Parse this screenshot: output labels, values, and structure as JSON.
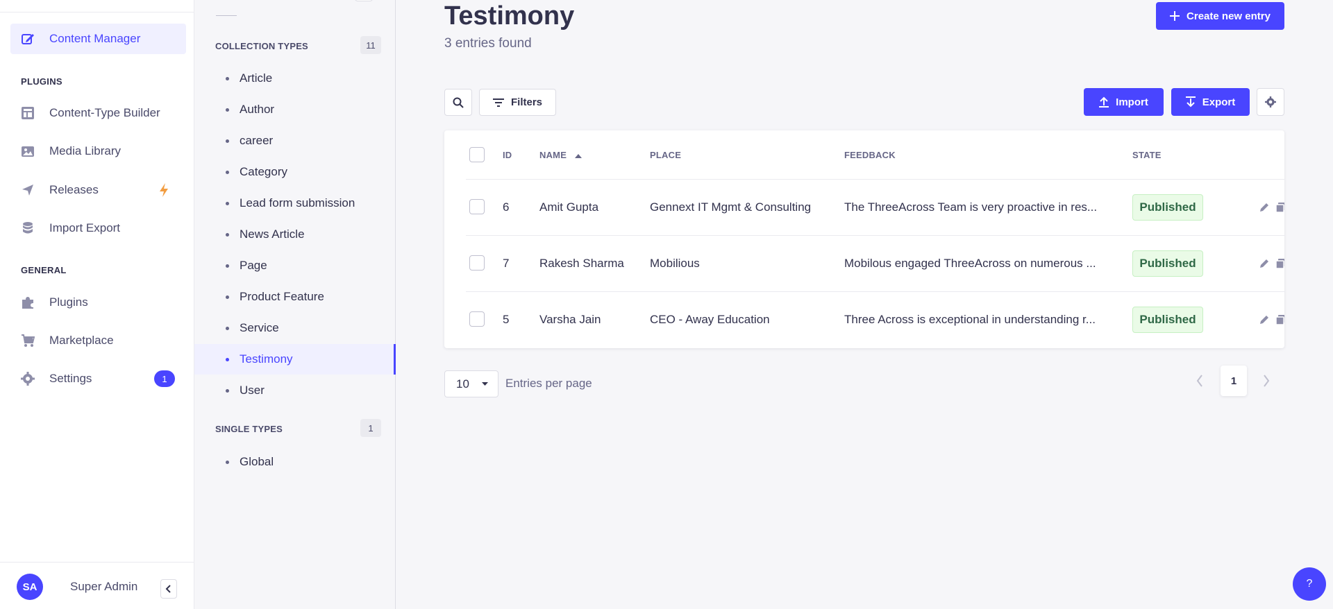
{
  "mainnav": {
    "content_manager": "Content Manager",
    "plugins_section": "PLUGINS",
    "content_type_builder": "Content-Type Builder",
    "media_library": "Media Library",
    "releases": "Releases",
    "import_export": "Import Export",
    "general_section": "GENERAL",
    "plugins": "Plugins",
    "marketplace": "Marketplace",
    "settings": "Settings",
    "settings_badge": "1",
    "user_initials": "SA",
    "user_name": "Super Admin"
  },
  "subnav": {
    "collection_types_label": "COLLECTION TYPES",
    "collection_types_count": "11",
    "collection_types": [
      "Article",
      "Author",
      "career",
      "Category",
      "Lead form submission",
      "News Article",
      "Page",
      "Product Feature",
      "Service",
      "Testimony",
      "User"
    ],
    "active_item": "Testimony",
    "single_types_label": "SINGLE TYPES",
    "single_types_count": "1",
    "single_types": [
      "Global"
    ]
  },
  "header": {
    "title": "Testimony",
    "subtitle": "3 entries found",
    "create_button": "Create new entry"
  },
  "toolbar": {
    "filters_label": "Filters",
    "import_label": "Import",
    "export_label": "Export"
  },
  "table": {
    "columns": {
      "id": "ID",
      "name": "NAME",
      "place": "PLACE",
      "feedback": "FEEDBACK",
      "state": "STATE"
    },
    "sort": {
      "column": "name",
      "direction": "ascending"
    },
    "rows": [
      {
        "id": "6",
        "name": "Amit Gupta",
        "place": "Gennext IT Mgmt & Consulting",
        "feedback": "The ThreeAcross Team is very proactive in res...",
        "state": "Published"
      },
      {
        "id": "7",
        "name": "Rakesh Sharma",
        "place": "Mobilious",
        "feedback": "Mobilous engaged ThreeAcross on numerous ...",
        "state": "Published"
      },
      {
        "id": "5",
        "name": "Varsha Jain",
        "place": "CEO - Away Education",
        "feedback": "Three Across is exceptional in understanding r...",
        "state": "Published"
      }
    ]
  },
  "pagination": {
    "per_page_value": "10",
    "per_page_label": "Entries per page",
    "current_page": "1"
  },
  "help": {
    "label": "?"
  },
  "colors": {
    "accent": "#4945ff",
    "published_bg": "#eafbe7",
    "published_text": "#2f6846",
    "bolt": "#f29d41"
  },
  "icons": [
    "pencil-square-icon",
    "layout-icon",
    "image-icon",
    "paper-plane-icon",
    "bolt-icon",
    "database-icon",
    "puzzle-icon",
    "cart-icon",
    "gear-icon",
    "chevron-left-icon",
    "plus-icon",
    "search-icon",
    "filter-icon",
    "upload-icon",
    "download-icon",
    "sort-up-icon",
    "edit-icon",
    "duplicate-icon",
    "caret-down-icon",
    "chevron-right-icon"
  ]
}
